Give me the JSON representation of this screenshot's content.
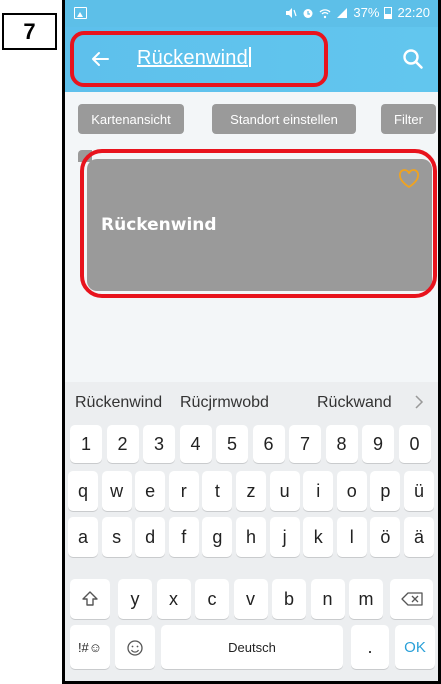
{
  "step": {
    "number": "7"
  },
  "status_bar": {
    "battery": "37%",
    "time": "22:20"
  },
  "app_bar": {
    "search_text": "Rückenwind"
  },
  "chips": [
    "Kartenansicht",
    "Standort einstellen",
    "Filter"
  ],
  "result_card": {
    "title": "Rückenwind",
    "favorite_color": "#f0a31f"
  },
  "keyboard": {
    "suggestions": [
      "Rückenwind",
      "Rücjrmwobd",
      "Rückwand"
    ],
    "row_numbers": [
      "1",
      "2",
      "3",
      "4",
      "5",
      "6",
      "7",
      "8",
      "9",
      "0"
    ],
    "row_1": [
      "q",
      "w",
      "e",
      "r",
      "t",
      "z",
      "u",
      "i",
      "o",
      "p",
      "ü"
    ],
    "row_2": [
      "a",
      "s",
      "d",
      "f",
      "g",
      "h",
      "j",
      "k",
      "l",
      "ö",
      "ä"
    ],
    "row_3": [
      "y",
      "x",
      "c",
      "v",
      "b",
      "n",
      "m"
    ],
    "symbols_label": "!#☺",
    "space_label": "Deutsch",
    "period_label": ".",
    "ok_label": "OK"
  },
  "colors": {
    "accent": "#5ec0ec",
    "highlight": "#e8131d",
    "card": "#9a9a9a"
  }
}
